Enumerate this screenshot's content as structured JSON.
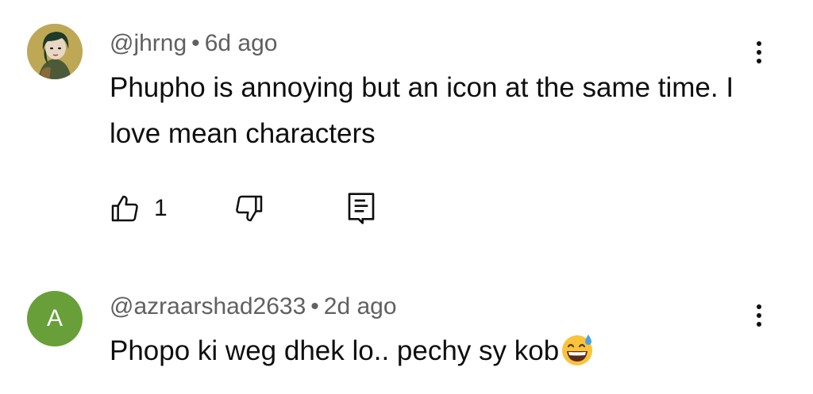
{
  "comments": [
    {
      "handle": "@jhrng",
      "separator": "•",
      "time": "6d ago",
      "text": "Phupho is annoying but an icon at the same time. I love mean characters",
      "like_count": "1",
      "avatar_type": "image"
    },
    {
      "handle": "@azraarshad2633",
      "separator": "•",
      "time": "2d ago",
      "text": "Phopo ki weg dhek lo.. pechy sy kob",
      "avatar_letter": "A",
      "avatar_color": "#689f38",
      "emoji": "grinning-face-with-sweat"
    }
  ],
  "icons": {
    "like": "thumbs-up-icon",
    "dislike": "thumbs-down-icon",
    "reply": "reply-icon",
    "menu": "more-vert-icon"
  }
}
